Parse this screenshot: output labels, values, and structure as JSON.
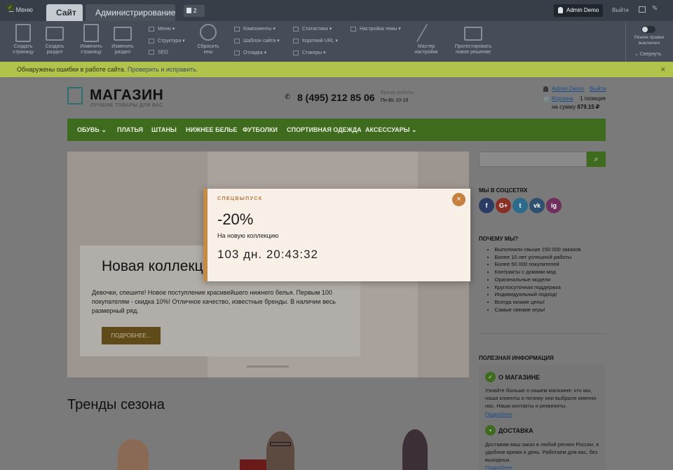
{
  "admin": {
    "menu_label": "Меню",
    "tab_site": "Сайт",
    "tab_admin": "Администрирование",
    "notifications_count": "2",
    "user": "Admin Demo",
    "logout": "Выйти"
  },
  "toolbar": {
    "create_page": [
      "Создать",
      "страницу"
    ],
    "create_section": [
      "Создать",
      "раздел"
    ],
    "edit_page": [
      "Изменить",
      "страницу"
    ],
    "edit_section": [
      "Изменить",
      "раздел"
    ],
    "menu": "Меню",
    "structure": "Структура",
    "seo": "SEO",
    "reset_cache": [
      "Сбросить",
      "кеш"
    ],
    "components": "Компоненты",
    "site_template": "Шаблон сайта",
    "debug": "Отладка",
    "statistics": "Статистика",
    "short_url": "Короткий URL",
    "stickers": "Стикеры",
    "theme_settings": "Настройка темы",
    "wizard": [
      "Мастер",
      "настройки"
    ],
    "test_solution": [
      "Протестировать",
      "новое решение"
    ],
    "edit_mode": [
      "Режим правки",
      "выключен"
    ],
    "collapse": "Свернуть"
  },
  "warning": {
    "text": "Обнаружены ошибки в работе сайта.",
    "fix_link": "Проверить и исправить."
  },
  "header": {
    "logo_title": "МАГАЗИН",
    "logo_subtitle": "ЛУЧШИЕ ТОВАРЫ ДЛЯ ВАС",
    "phone": "8 (495) 212 85 06",
    "hours_label": "Время работы:",
    "hours_value": "Пн-Вс 10-19",
    "user_link": "Admin Demo",
    "logout_link": "Выйти",
    "cart_link": "Корзина",
    "cart_positions": "1 позиция",
    "cart_sum_label": "на сумму",
    "cart_sum": "679.15 ₽"
  },
  "nav": [
    "ОБУВЬ",
    "ПЛАТЬЯ",
    "ШТАНЫ",
    "НИЖНЕЕ БЕЛЬЕ",
    "ФУТБОЛКИ",
    "СПОРТИВНАЯ ОДЕЖДА",
    "АКСЕССУАРЫ"
  ],
  "slider": {
    "title": "Новая коллекция",
    "text": "Девочки, спешите! Новое поступление красивейшего нижнего белья. Первым 100 покупателям - скидка 10%! Отличное качество, известные бренды. В наличии весь размерный ряд.",
    "button": "ПОДРОБНЕЕ..."
  },
  "trends_title": "Тренды сезона",
  "sidebar": {
    "social_title": "МЫ В СОЦСЕТЯХ",
    "social": [
      {
        "name": "f",
        "color": "#2a3c63"
      },
      {
        "name": "G+",
        "color": "#8a2f26"
      },
      {
        "name": "t",
        "color": "#2b6b8c"
      },
      {
        "name": "vk",
        "color": "#30506f"
      },
      {
        "name": "ig",
        "color": "#70305e"
      }
    ],
    "why_title": "ПОЧЕМУ МЫ?",
    "why": [
      "Выполнили свыше 150 000 заказов",
      "Более 10 лет успешной работы",
      "Более 50 000 покупателей",
      "Контракты с домами мод",
      "Оригинальные модели",
      "Круглосуточная поддержка",
      "Индивидуальный подход!",
      "Всегда низкие цены!",
      "Самые свежие игры!"
    ],
    "info_title": "ПОЛЕЗНАЯ ИНФОРМАЦИЯ",
    "about_title": "О МАГАЗИНЕ",
    "about_text": "Узнайте больше о нашем магазине: кто мы, наши клиенты и почему они выбрали именно нас. Наши контакты и реквизиты.",
    "more": "Подробнее",
    "delivery_title": "ДОСТАВКА",
    "delivery_text": "Доставим ваш заказ в любой регион России, в удобное время и день. Работаем для вас, без выходных."
  },
  "popup": {
    "label": "СПЕЦВЫПУСК",
    "discount": "-20%",
    "text": "На новую коллекцию",
    "timer": "103 дн. 20:43:32",
    "close": "×"
  }
}
